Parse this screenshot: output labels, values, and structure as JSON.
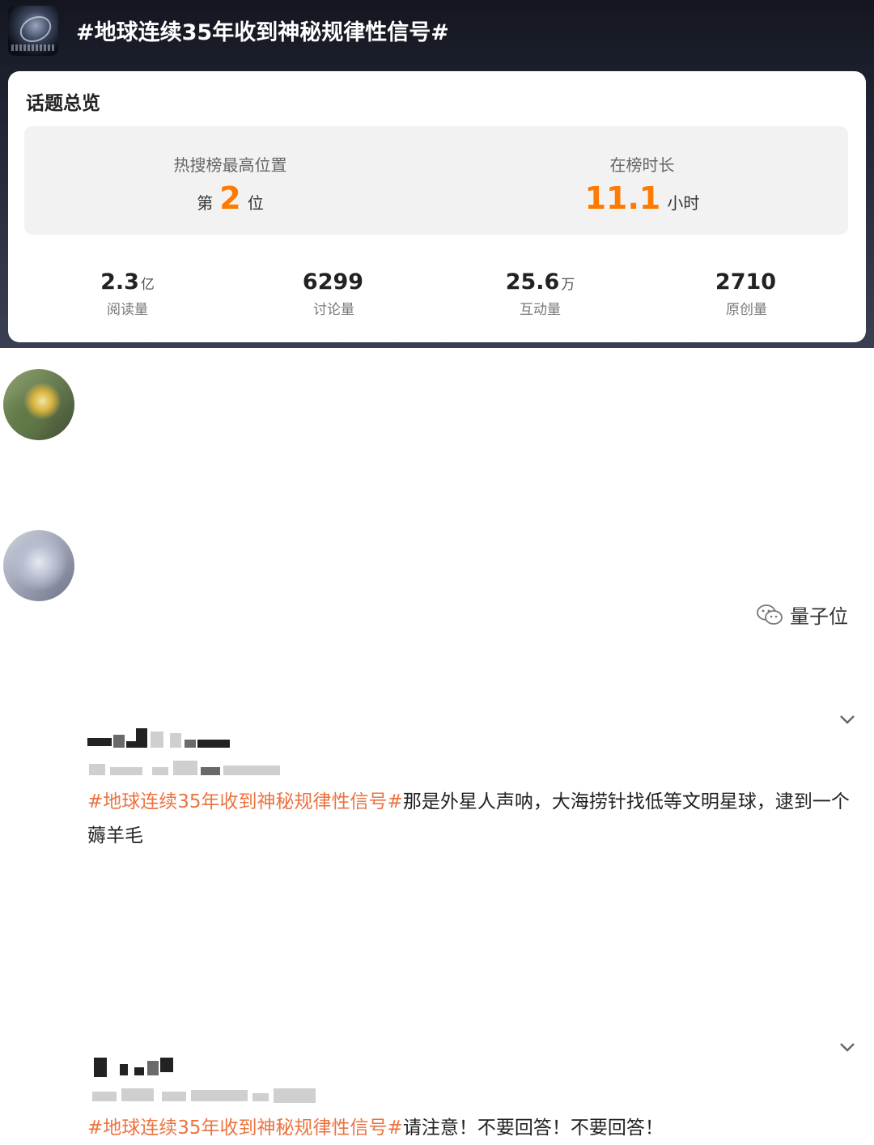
{
  "topic": {
    "title": "#地球连续35年收到神秘规律性信号#"
  },
  "overview": {
    "heading": "话题总览",
    "peak_rank": {
      "label": "热搜榜最高位置",
      "prefix": "第",
      "value": "2",
      "suffix": "位"
    },
    "duration": {
      "label": "在榜时长",
      "value": "11.1",
      "unit": "小时"
    },
    "stats": [
      {
        "value": "2.3",
        "unit": "亿",
        "label": "阅读量"
      },
      {
        "value": "6299",
        "unit": "",
        "label": "讨论量"
      },
      {
        "value": "25.6",
        "unit": "万",
        "label": "互动量"
      },
      {
        "value": "2710",
        "unit": "",
        "label": "原创量"
      }
    ]
  },
  "posts": [
    {
      "hashtag": "#地球连续35年收到神秘规律性信号#",
      "body": "那是外星人声呐，大海捞针找低等文明星球，逮到一个薅羊毛"
    },
    {
      "hashtag": "#地球连续35年收到神秘规律性信号#",
      "body": "请注意！不要回答！不要回答！"
    }
  ],
  "watermark": {
    "text": "量子位",
    "icon": "wechat-icon"
  },
  "colors": {
    "accent_orange": "#ff7a00",
    "hashtag": "#eb7340",
    "header_bg": "#1b1e2a"
  }
}
